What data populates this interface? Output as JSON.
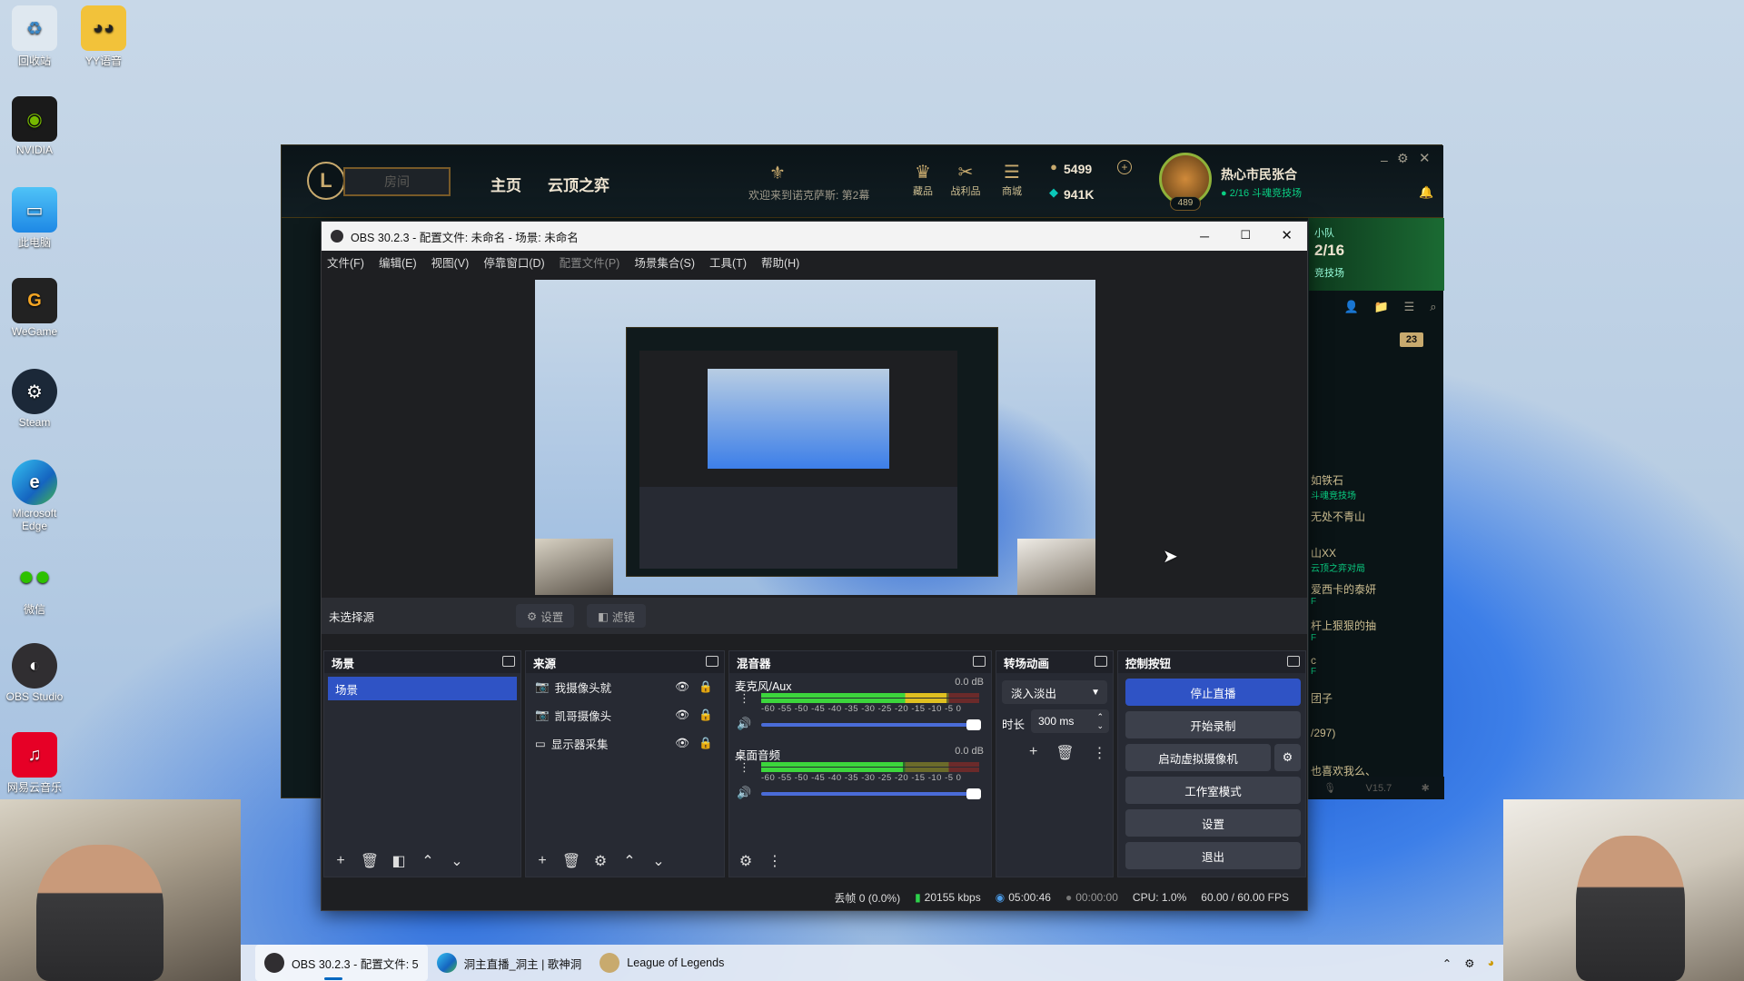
{
  "desktop": {
    "icons": [
      {
        "label": "回收站",
        "icon": "recycle-bin-icon",
        "color": "#9ad"
      },
      {
        "label": "YY语音",
        "icon": "yy-voice-icon",
        "color": "#f2c23a"
      },
      {
        "label": "NVIDIA",
        "icon": "nvidia-icon",
        "color": "#76b900"
      },
      {
        "label": "此电脑",
        "icon": "this-pc-icon",
        "color": "#3aa0e8"
      },
      {
        "label": "WeGame",
        "icon": "wegame-icon",
        "color": "#f5a623"
      },
      {
        "label": "Steam",
        "icon": "steam-icon",
        "color": "#1b2838"
      },
      {
        "label": "Microsoft Edge",
        "icon": "edge-icon",
        "color": "#1e90d8"
      },
      {
        "label": "微信",
        "icon": "wechat-icon",
        "color": "#2dc100"
      },
      {
        "label": "OBS Studio",
        "icon": "obs-icon",
        "color": "#302e31"
      },
      {
        "label": "网易云音乐",
        "icon": "netease-music-icon",
        "color": "#e60026"
      }
    ]
  },
  "lol": {
    "nav": [
      "主页",
      "云顶之弈"
    ],
    "room_placeholder": "房间",
    "welcome": "欢迎来到诺克萨斯: 第2幕",
    "icons": [
      {
        "label": "藏品",
        "icon": "collection-icon"
      },
      {
        "label": "战利品",
        "icon": "loot-icon"
      },
      {
        "label": "商城",
        "icon": "store-icon"
      }
    ],
    "currency_be": "5499",
    "currency_rp": "941K",
    "summoner_name": "热心市民张合",
    "summoner_level": "489",
    "summoner_status": "2/16 斗魂竞技场",
    "side": {
      "team_label": "小队",
      "count": "2/16",
      "mode": "竞技场",
      "badge": "23",
      "friends": [
        {
          "name": "如铁石",
          "status": "斗魂竞技场"
        },
        {
          "name": "无处不青山",
          "status": ""
        },
        {
          "name": "山XX",
          "status": "云顶之弈对局"
        },
        {
          "name": "爱西卡的泰妍",
          "status": "F"
        },
        {
          "name": "杆上狠狠的抽",
          "status": "F"
        },
        {
          "name": "c",
          "status": "F"
        },
        {
          "name": "团子",
          "status": ""
        },
        {
          "name": "/297)",
          "status": ""
        },
        {
          "name": "也喜欢我么、",
          "status": ""
        }
      ],
      "version": "V15.7"
    }
  },
  "obs": {
    "title": "OBS 30.2.3 - 配置文件: 未命名 - 场景: 未命名",
    "menu": [
      "文件(F)",
      "编辑(E)",
      "视图(V)",
      "停靠窗口(D)",
      "配置文件(P)",
      "场景集合(S)",
      "工具(T)",
      "帮助(H)"
    ],
    "no_source": "未选择源",
    "props_btn": "设置",
    "filters_btn": "滤镜",
    "scenes": {
      "title": "场景",
      "items": [
        "场景"
      ]
    },
    "sources": {
      "title": "来源",
      "items": [
        {
          "name": "我摄像头就",
          "icon": "camera-icon"
        },
        {
          "name": "凯哥摄像头",
          "icon": "camera-icon"
        },
        {
          "name": "显示器采集",
          "icon": "monitor-icon"
        }
      ]
    },
    "mixer": {
      "title": "混音器",
      "channels": [
        {
          "name": "麦克风/Aux",
          "db": "0.0 dB",
          "level": 0.85
        },
        {
          "name": "桌面音频",
          "db": "0.0 dB",
          "level": 0.65
        }
      ],
      "scale": "-60 -55 -50 -45 -40 -35 -30 -25 -20 -15 -10 -5 0"
    },
    "transitions": {
      "title": "转场动画",
      "type": "淡入淡出",
      "duration_label": "时长",
      "duration": "300 ms"
    },
    "controls": {
      "title": "控制按钮",
      "buttons": [
        "停止直播",
        "开始录制",
        "启动虚拟摄像机",
        "工作室模式",
        "设置",
        "退出"
      ]
    },
    "status": {
      "dropped": "丢帧 0 (0.0%)",
      "bitrate": "20155 kbps",
      "live_time": "05:00:46",
      "rec_time": "00:00:00",
      "cpu": "CPU: 1.0%",
      "fps": "60.00 / 60.00 FPS"
    }
  },
  "taskbar": {
    "items": [
      {
        "label": "OBS 30.2.3 - 配置文件: 5",
        "icon": "obs-icon"
      },
      {
        "label": "洞主直播_洞主 | 歌神洞",
        "icon": "edge-icon"
      },
      {
        "label": "League of Legends",
        "icon": "lol-icon"
      }
    ]
  }
}
